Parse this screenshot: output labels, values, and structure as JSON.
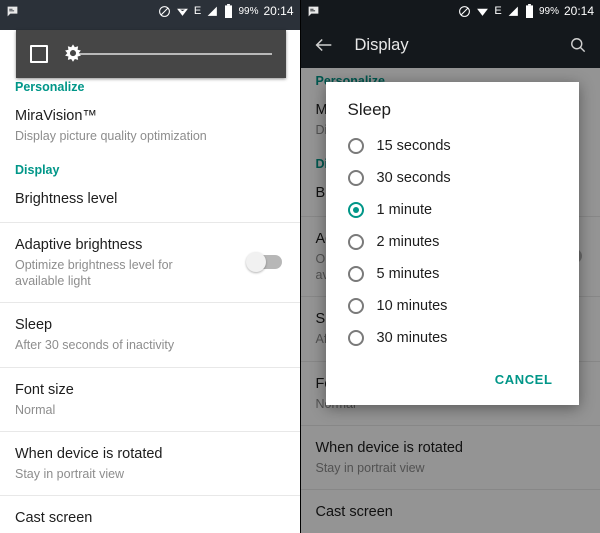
{
  "status_bar": {
    "notification_icon": "message-icon",
    "icons": [
      "do-not-disturb-icon",
      "wifi-icon",
      "edge-network-icon",
      "signal-bars-icon",
      "battery-icon"
    ],
    "network_label": "E",
    "battery_percent": "99%",
    "time": "20:14"
  },
  "colors": {
    "accent": "#009688",
    "statusbar_left": "#2b3139",
    "statusbar_right": "#14181c",
    "toolbar": "#14181c",
    "brightness_panel": "#464646"
  },
  "left_panel": {
    "brightness_overlay": {
      "auto_toggle_name": "auto-brightness-checkbox",
      "slider_icon": "brightness-sun-icon",
      "slider_value": "0"
    },
    "sections": [
      {
        "header": "Personalize",
        "rows": [
          {
            "title": "MiraVision™",
            "sub": "Display picture quality optimization"
          }
        ]
      },
      {
        "header": "Display",
        "rows": [
          {
            "title": "Brightness level",
            "sub": ""
          },
          {
            "title": "Adaptive brightness",
            "sub": "Optimize brightness level for available light",
            "switch": "off"
          },
          {
            "title": "Sleep",
            "sub": "After 30 seconds of inactivity"
          },
          {
            "title": "Font size",
            "sub": "Normal"
          },
          {
            "title": "When device is rotated",
            "sub": "Stay in portrait view"
          },
          {
            "title": "Cast screen",
            "sub": ""
          }
        ]
      }
    ]
  },
  "right_panel": {
    "toolbar": {
      "back_icon": "back-arrow-icon",
      "title": "Display",
      "search_icon": "search-icon"
    },
    "background_sections": [
      {
        "header": "Personalize",
        "rows": [
          {
            "title": "MiraVision™",
            "sub": "Display picture quality optimization"
          }
        ]
      },
      {
        "header": "Display",
        "rows": [
          {
            "title": "Brightness level",
            "sub": ""
          },
          {
            "title": "Adaptive brightness",
            "sub": "Optimize brightness level for available light",
            "switch": "off"
          },
          {
            "title": "Sleep",
            "sub": "After 30 seconds of inactivity"
          },
          {
            "title": "Font size",
            "sub": "Normal"
          },
          {
            "title": "When device is rotated",
            "sub": "Stay in portrait view"
          },
          {
            "title": "Cast screen",
            "sub": ""
          }
        ]
      }
    ],
    "dialog": {
      "title": "Sleep",
      "options": [
        {
          "label": "15 seconds",
          "selected": false
        },
        {
          "label": "30 seconds",
          "selected": false
        },
        {
          "label": "1 minute",
          "selected": true
        },
        {
          "label": "2 minutes",
          "selected": false
        },
        {
          "label": "5 minutes",
          "selected": false
        },
        {
          "label": "10 minutes",
          "selected": false
        },
        {
          "label": "30 minutes",
          "selected": false
        }
      ],
      "cancel_label": "CANCEL"
    }
  }
}
